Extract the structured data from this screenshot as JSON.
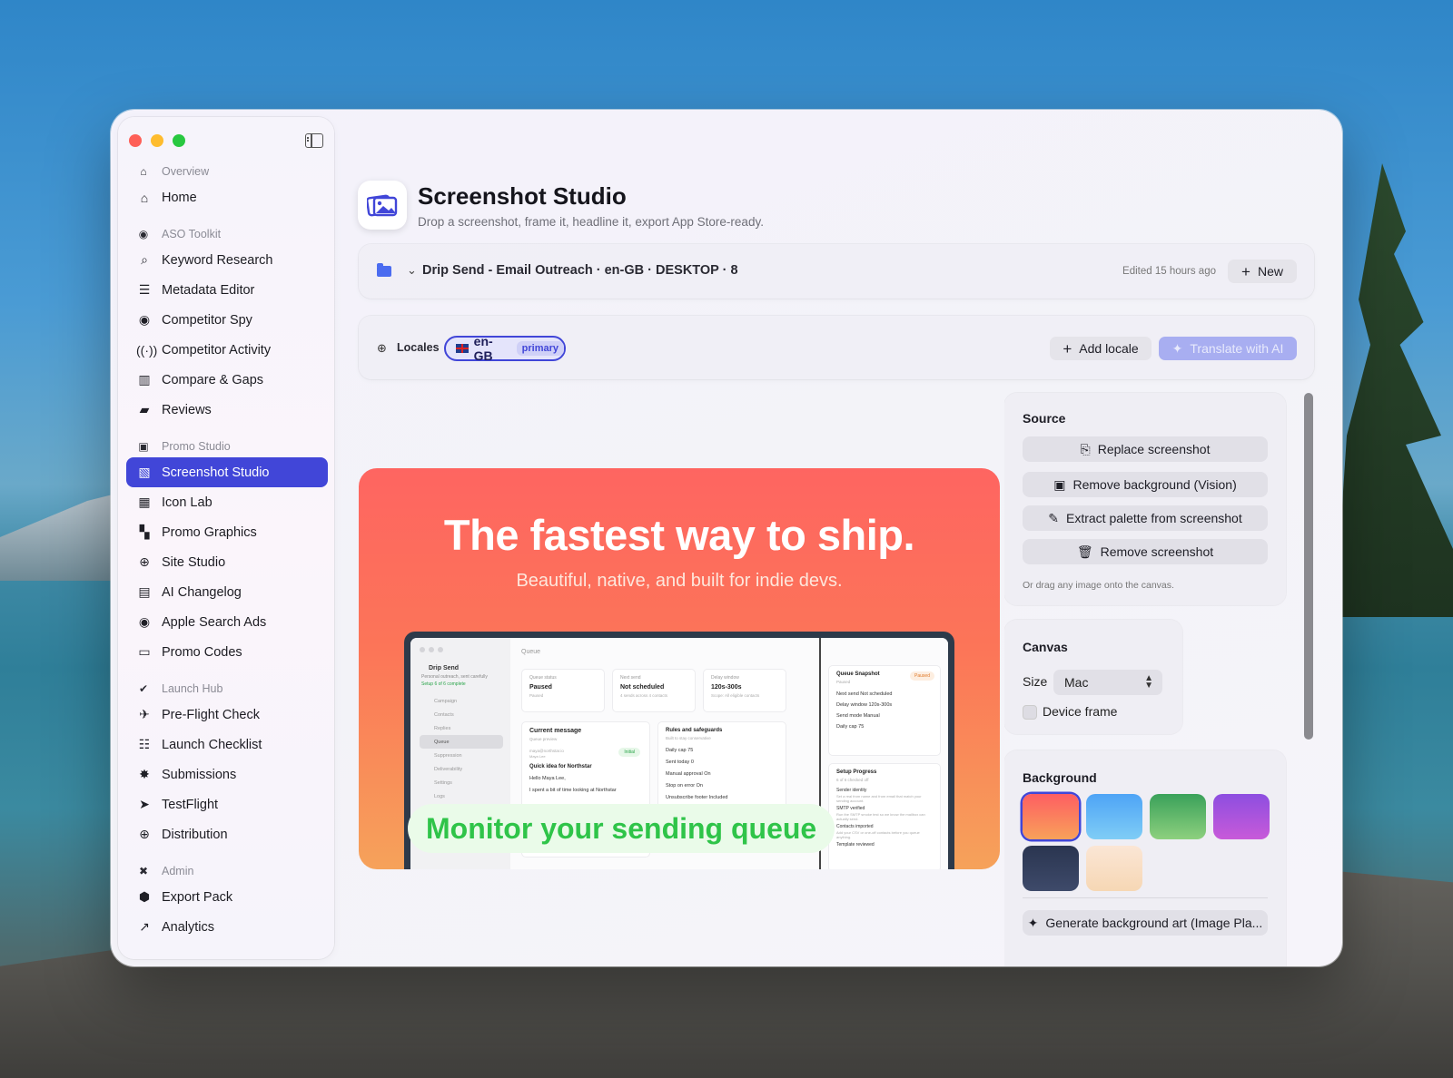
{
  "sidebar": {
    "sections": [
      {
        "label": "Overview",
        "items": [
          {
            "label": "Home"
          }
        ]
      },
      {
        "label": "ASO Toolkit",
        "items": [
          {
            "label": "Keyword Research"
          },
          {
            "label": "Metadata Editor"
          },
          {
            "label": "Competitor Spy"
          },
          {
            "label": "Competitor Activity"
          },
          {
            "label": "Compare & Gaps"
          },
          {
            "label": "Reviews"
          }
        ]
      },
      {
        "label": "Promo Studio",
        "items": [
          {
            "label": "Screenshot Studio"
          },
          {
            "label": "Icon Lab"
          },
          {
            "label": "Promo Graphics"
          },
          {
            "label": "Site Studio"
          },
          {
            "label": "AI Changelog"
          },
          {
            "label": "Apple Search Ads"
          },
          {
            "label": "Promo Codes"
          }
        ]
      },
      {
        "label": "Launch Hub",
        "items": [
          {
            "label": "Pre-Flight Check"
          },
          {
            "label": "Launch Checklist"
          },
          {
            "label": "Submissions"
          },
          {
            "label": "TestFlight"
          },
          {
            "label": "Distribution"
          }
        ]
      },
      {
        "label": "Admin",
        "items": [
          {
            "label": "Export Pack"
          },
          {
            "label": "Analytics"
          }
        ]
      }
    ],
    "active_item": "Screenshot Studio"
  },
  "header": {
    "title": "Screenshot Studio",
    "subtitle": "Drop a screenshot, frame it, headline it, export App Store-ready."
  },
  "project": {
    "name": "Drip Send - Email Outreach · en-GB · DESKTOP · 8",
    "edited": "Edited 15 hours ago",
    "new_label": "New"
  },
  "locales": {
    "label": "Locales",
    "current": "en-GB",
    "current_badge": "primary",
    "add_label": "Add locale",
    "translate_label": "Translate with AI"
  },
  "preview": {
    "headline": "The fastest way to ship.",
    "subheadline": "Beautiful, native, and built for indie devs.",
    "caption": "Monitor your sending queue",
    "mock": {
      "header": "Queue",
      "app_name": "Drip Send",
      "app_sub": "Personal outreach, sent carefully",
      "app_progress": "Setup 6 of 6 complete",
      "nav": [
        "Campaign",
        "Contacts",
        "Replies",
        "Queue",
        "Suppression",
        "Deliverability",
        "Settings",
        "Logs"
      ],
      "stats": [
        {
          "key": "Queue status",
          "value": "Paused",
          "sub": "Paused"
        },
        {
          "key": "Next send",
          "value": "Not scheduled",
          "sub": "4 sends across 4 contacts"
        },
        {
          "key": "Delay window",
          "value": "120s-300s",
          "sub": "Scope: All eligible contacts"
        }
      ],
      "current_message": "Current message",
      "queue_preview": "Queue preview",
      "email": "maya@northstar.io",
      "contact_name": "Maya Lee",
      "initial": "Initial",
      "idea": "Quick idea for Northstar",
      "greeting": "Hello Maya Lee,",
      "body": "I spent a bit of time looking at Northstar",
      "footer_note": "4 sends across 4 contacts",
      "rules_title": "Rules and safeguards",
      "rules_sub": "Built to stay conservative",
      "rules": [
        "Daily cap  75",
        "Sent today  0",
        "Manual approval  On",
        "Stop on error  On",
        "Unsubscribe footer  Included"
      ],
      "snapshot_title": "Queue Snapshot",
      "snapshot_sub": "Paused",
      "snapshot_badge": "Paused",
      "snapshot_rows": [
        "Next send  Not scheduled",
        "Delay window  120s-300s",
        "Send mode  Manual",
        "Daily cap  75"
      ],
      "setup_title": "Setup Progress",
      "setup_sub": "6 of 6 checked off",
      "setup_items": [
        "Sender identity",
        "SMTP verified",
        "Contacts imported",
        "Template reviewed"
      ],
      "setup_notes": [
        "Set a real from name and from email that match your sending account.",
        "Run the SMTP smoke test so we know the mailbox can actually send.",
        "Add your CSV or one-off contacts before you queue anything."
      ]
    }
  },
  "inspector": {
    "source": {
      "title": "Source",
      "replace": "Replace screenshot",
      "remove_bg": "Remove background (Vision)",
      "extract": "Extract palette from screenshot",
      "remove": "Remove screenshot",
      "hint": "Or drag any image onto the canvas."
    },
    "canvas": {
      "title": "Canvas",
      "size_label": "Size",
      "size_value": "Mac",
      "device_frame": "Device frame"
    },
    "background": {
      "title": "Background",
      "generate": "Generate background art (Image Pla..."
    }
  },
  "colors": {
    "accent": "#4146d8",
    "caption_green": "#2fc449",
    "swatches": [
      "coral-orange",
      "sky-blue",
      "green",
      "violet",
      "navy",
      "peach"
    ]
  }
}
